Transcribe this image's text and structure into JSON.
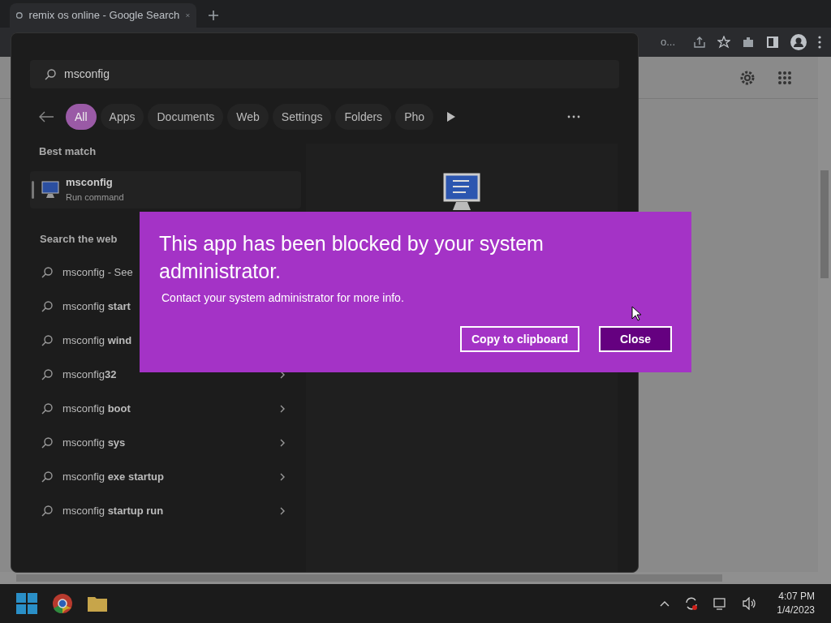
{
  "browser": {
    "tab_title": "remix os online - Google Search",
    "omnibox_text": "o..."
  },
  "start_search": {
    "query": "msconfig",
    "filters": [
      {
        "label": "All",
        "selected": true
      },
      {
        "label": "Apps",
        "selected": false
      },
      {
        "label": "Documents",
        "selected": false
      },
      {
        "label": "Web",
        "selected": false
      },
      {
        "label": "Settings",
        "selected": false
      },
      {
        "label": "Folders",
        "selected": false
      },
      {
        "label": "Pho",
        "selected": false
      }
    ],
    "best_match_heading": "Best match",
    "best_match": {
      "title": "msconfig",
      "subtitle": "Run command"
    },
    "web_heading": "Search the web",
    "web_results": [
      {
        "text": "msconfig - See",
        "arrow": false
      },
      {
        "text": "msconfig **start**",
        "arrow": false
      },
      {
        "text": "msconfig **wind**",
        "arrow": false
      },
      {
        "text": "msconfig**32**",
        "arrow": true
      },
      {
        "text": "msconfig **boot**",
        "arrow": true
      },
      {
        "text": "msconfig **sys**",
        "arrow": true
      },
      {
        "text": "msconfig **exe startup**",
        "arrow": true
      },
      {
        "text": "msconfig **startup run**",
        "arrow": true
      }
    ]
  },
  "dialog": {
    "title": "This app has been blocked by your system administrator.",
    "message": "Contact your system administrator for more info.",
    "buttons": [
      {
        "label": "Copy to clipboard",
        "kind": "outline"
      },
      {
        "label": "Close",
        "kind": "primary"
      }
    ]
  },
  "taskbar": {
    "time": "4:07 PM",
    "date": "1/4/2023"
  }
}
